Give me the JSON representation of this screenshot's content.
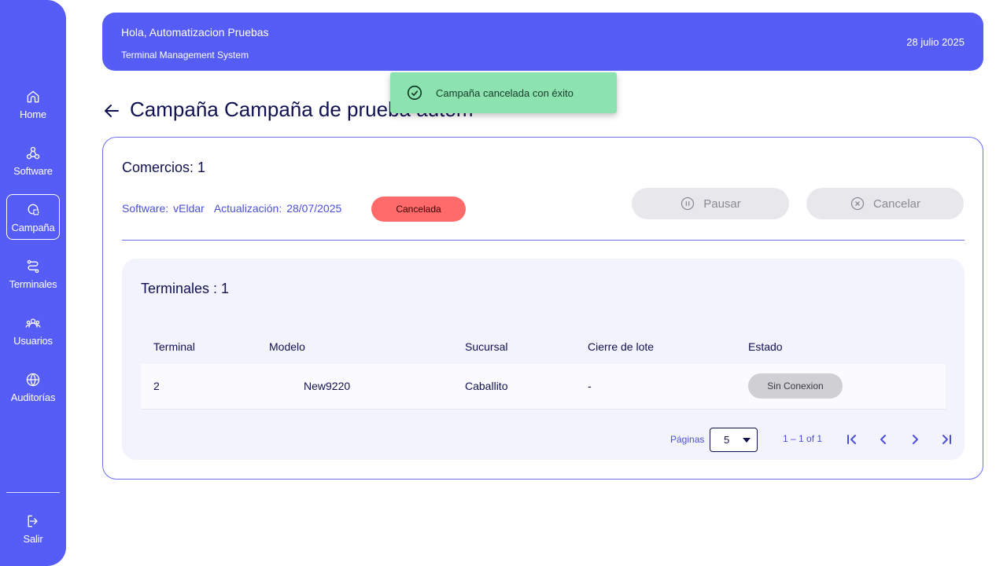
{
  "sidebar": {
    "items": [
      {
        "label": "Home",
        "icon": "home-icon"
      },
      {
        "label": "Software",
        "icon": "webhook-icon"
      },
      {
        "label": "Campaña",
        "icon": "campaign-icon",
        "active": true
      },
      {
        "label": "Terminales",
        "icon": "route-icon"
      },
      {
        "label": "Usuarios",
        "icon": "users-icon"
      },
      {
        "label": "Auditorías",
        "icon": "globe-icon"
      }
    ],
    "logout_label": "Salir"
  },
  "header": {
    "greeting": "Hola, Automatizacion Pruebas",
    "subtitle": "Terminal Management System",
    "date": "28 julio 2025"
  },
  "toast": {
    "message": "Campaña cancelada con éxito",
    "icon": "check-circle-icon"
  },
  "page": {
    "title": "Campaña Campaña de prueba autom"
  },
  "campaign": {
    "comercios": "Comercios: 1",
    "software_label": "Software:",
    "software_value": "vEldar",
    "update_label": "Actualización:",
    "update_value": "28/07/2025",
    "status": "Cancelada",
    "pause_label": "Pausar",
    "cancel_label": "Cancelar"
  },
  "terminals": {
    "title": "Terminales : 1",
    "columns": [
      "Terminal",
      "Modelo",
      "Sucursal",
      "Cierre de lote",
      "Estado"
    ],
    "rows": [
      {
        "terminal": "2",
        "modelo": "New9220",
        "sucursal": "Caballito",
        "cierre": "-",
        "estado": "Sin Conexion"
      }
    ],
    "pagination": {
      "label": "Páginas",
      "page_size": "5",
      "range": "1 – 1 of 1"
    }
  },
  "colors": {
    "primary": "#565cf6",
    "toast_bg": "#8ce3b0",
    "cancelled_badge": "#ff6b6b",
    "disconnected_chip": "#cfcfd4"
  }
}
